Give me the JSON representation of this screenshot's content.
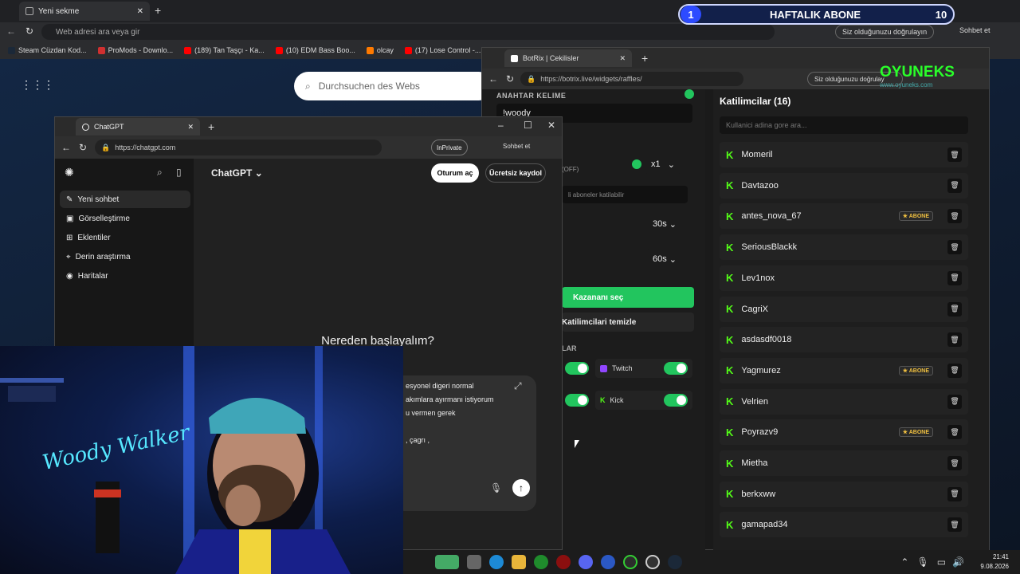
{
  "subscriber_bar": {
    "left_count": "1",
    "title": "HAFTALIK ABONE",
    "right_count": "10"
  },
  "background_browser": {
    "tab_title": "Yeni sekme",
    "address_placeholder": "Web adresi ara veya gir",
    "verify_text": "Siz olduğunuzu doğrulayın",
    "chat_label": "Sohbet et",
    "bookmarks": [
      {
        "label": "Steam Cüzdan Kod...",
        "color": "#1b2838"
      },
      {
        "label": "ProMods - Downlo...",
        "color": "#d03030"
      },
      {
        "label": "(189) Tan Taşçı - Ka...",
        "color": "#ff0000"
      },
      {
        "label": "(10) EDM Bass Boo...",
        "color": "#ff0000"
      },
      {
        "label": "olcay",
        "color": "#ff7a00"
      },
      {
        "label": "(17) Lose Control -...",
        "color": "#ff0000"
      }
    ],
    "search_placeholder": "Durchsuchen des Webs"
  },
  "botrix": {
    "tab_title": "BotRix | Cekilisler",
    "url": "https://botrix.live/widgets/raffles/",
    "verify_text": "Siz olduğunuzu doğrulay",
    "keyword_label": "ANAHTAR KELIME",
    "keyword_value": "!woody",
    "sub_only_state": "(OFF)",
    "multiplier": "x1",
    "subs_can_join": "li aboneler katilabilir",
    "timer_a": "30s",
    "timer_b": "60s",
    "pick_winner": "Kazananı seç",
    "clear_participants": "Katilimcilari temizle",
    "platforms_label": "LAR",
    "platform_twitch": "Twitch",
    "platform_kick": "Kick",
    "participants_title": "Katilimcilar (16)",
    "participant_search_placeholder": "Kullanici adina gore ara...",
    "abone_label": "ABONE",
    "participants": [
      {
        "name": "Momeril",
        "sub": false
      },
      {
        "name": "Davtazoo",
        "sub": false
      },
      {
        "name": "antes_nova_67",
        "sub": true
      },
      {
        "name": "SeriousBlackk",
        "sub": false
      },
      {
        "name": "Lev1nox",
        "sub": false
      },
      {
        "name": "CagriX",
        "sub": false
      },
      {
        "name": "asdasdf0018",
        "sub": false
      },
      {
        "name": "Yagmurez",
        "sub": true
      },
      {
        "name": "Velrien",
        "sub": false
      },
      {
        "name": "Poyrazv9",
        "sub": true
      },
      {
        "name": "Mietha",
        "sub": false
      },
      {
        "name": "berkxww",
        "sub": false
      },
      {
        "name": "gamapad34",
        "sub": false
      }
    ]
  },
  "chatgpt": {
    "tab_title": "ChatGPT",
    "url": "https://chatgpt.com",
    "inprivate": "InPrivate",
    "chat_label": "Sohbet et",
    "sidebar": [
      "Yeni sohbet",
      "Görselleştirme",
      "Eklentiler",
      "Derin araştırma",
      "Haritalar"
    ],
    "model": "ChatGPT",
    "login": "Oturum aç",
    "signup": "Ücretsiz kaydol",
    "headline": "Nereden başlayalım?",
    "input_lines": [
      "esyonel digeri normal",
      "akımlara ayırmanı istiyorum",
      "u vermen gerek",
      ", çagrı ,"
    ]
  },
  "taskbar": {
    "time": "21:41",
    "date": "9.08.2026"
  },
  "watermark": {
    "brand": "OYUNEKS",
    "site": "www.oyuneks.com"
  },
  "colors": {
    "accent_green": "#22c55e",
    "kick_green": "#53fc18",
    "sub_blue": "#2d4bff"
  }
}
